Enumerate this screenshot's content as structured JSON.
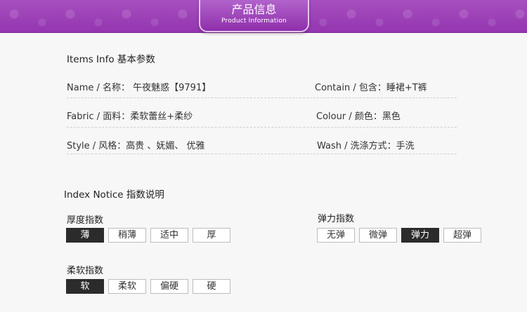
{
  "banner": {
    "title_zh": "产品信息",
    "title_en": "Product Information",
    "color": "#9a3fb5"
  },
  "items_info": {
    "title": "Items Info 基本参数",
    "left": [
      "Name / 名称： 午夜魅惑【9791】",
      "Fabric / 面料：柔软蕾丝+柔纱",
      "Style / 风格：高贵 、妩媚、 优雅"
    ],
    "right": [
      "Contain / 包含：睡裙+T裤",
      "Colour / 颜色：黑色",
      "Wash / 洗涤方式：手洗"
    ]
  },
  "index_notice": {
    "title": "Index Notice 指数说明",
    "thickness": {
      "label": "厚度指数",
      "options": [
        "薄",
        "稍薄",
        "适中",
        "厚"
      ],
      "selected": 0
    },
    "elasticity": {
      "label": "弹力指数",
      "options": [
        "无弹",
        "微弹",
        "弹力",
        "超弹"
      ],
      "selected": 2
    },
    "softness": {
      "label": "柔软指数",
      "options": [
        "软",
        "柔软",
        "偏硬",
        "硬"
      ],
      "selected": 0
    }
  }
}
